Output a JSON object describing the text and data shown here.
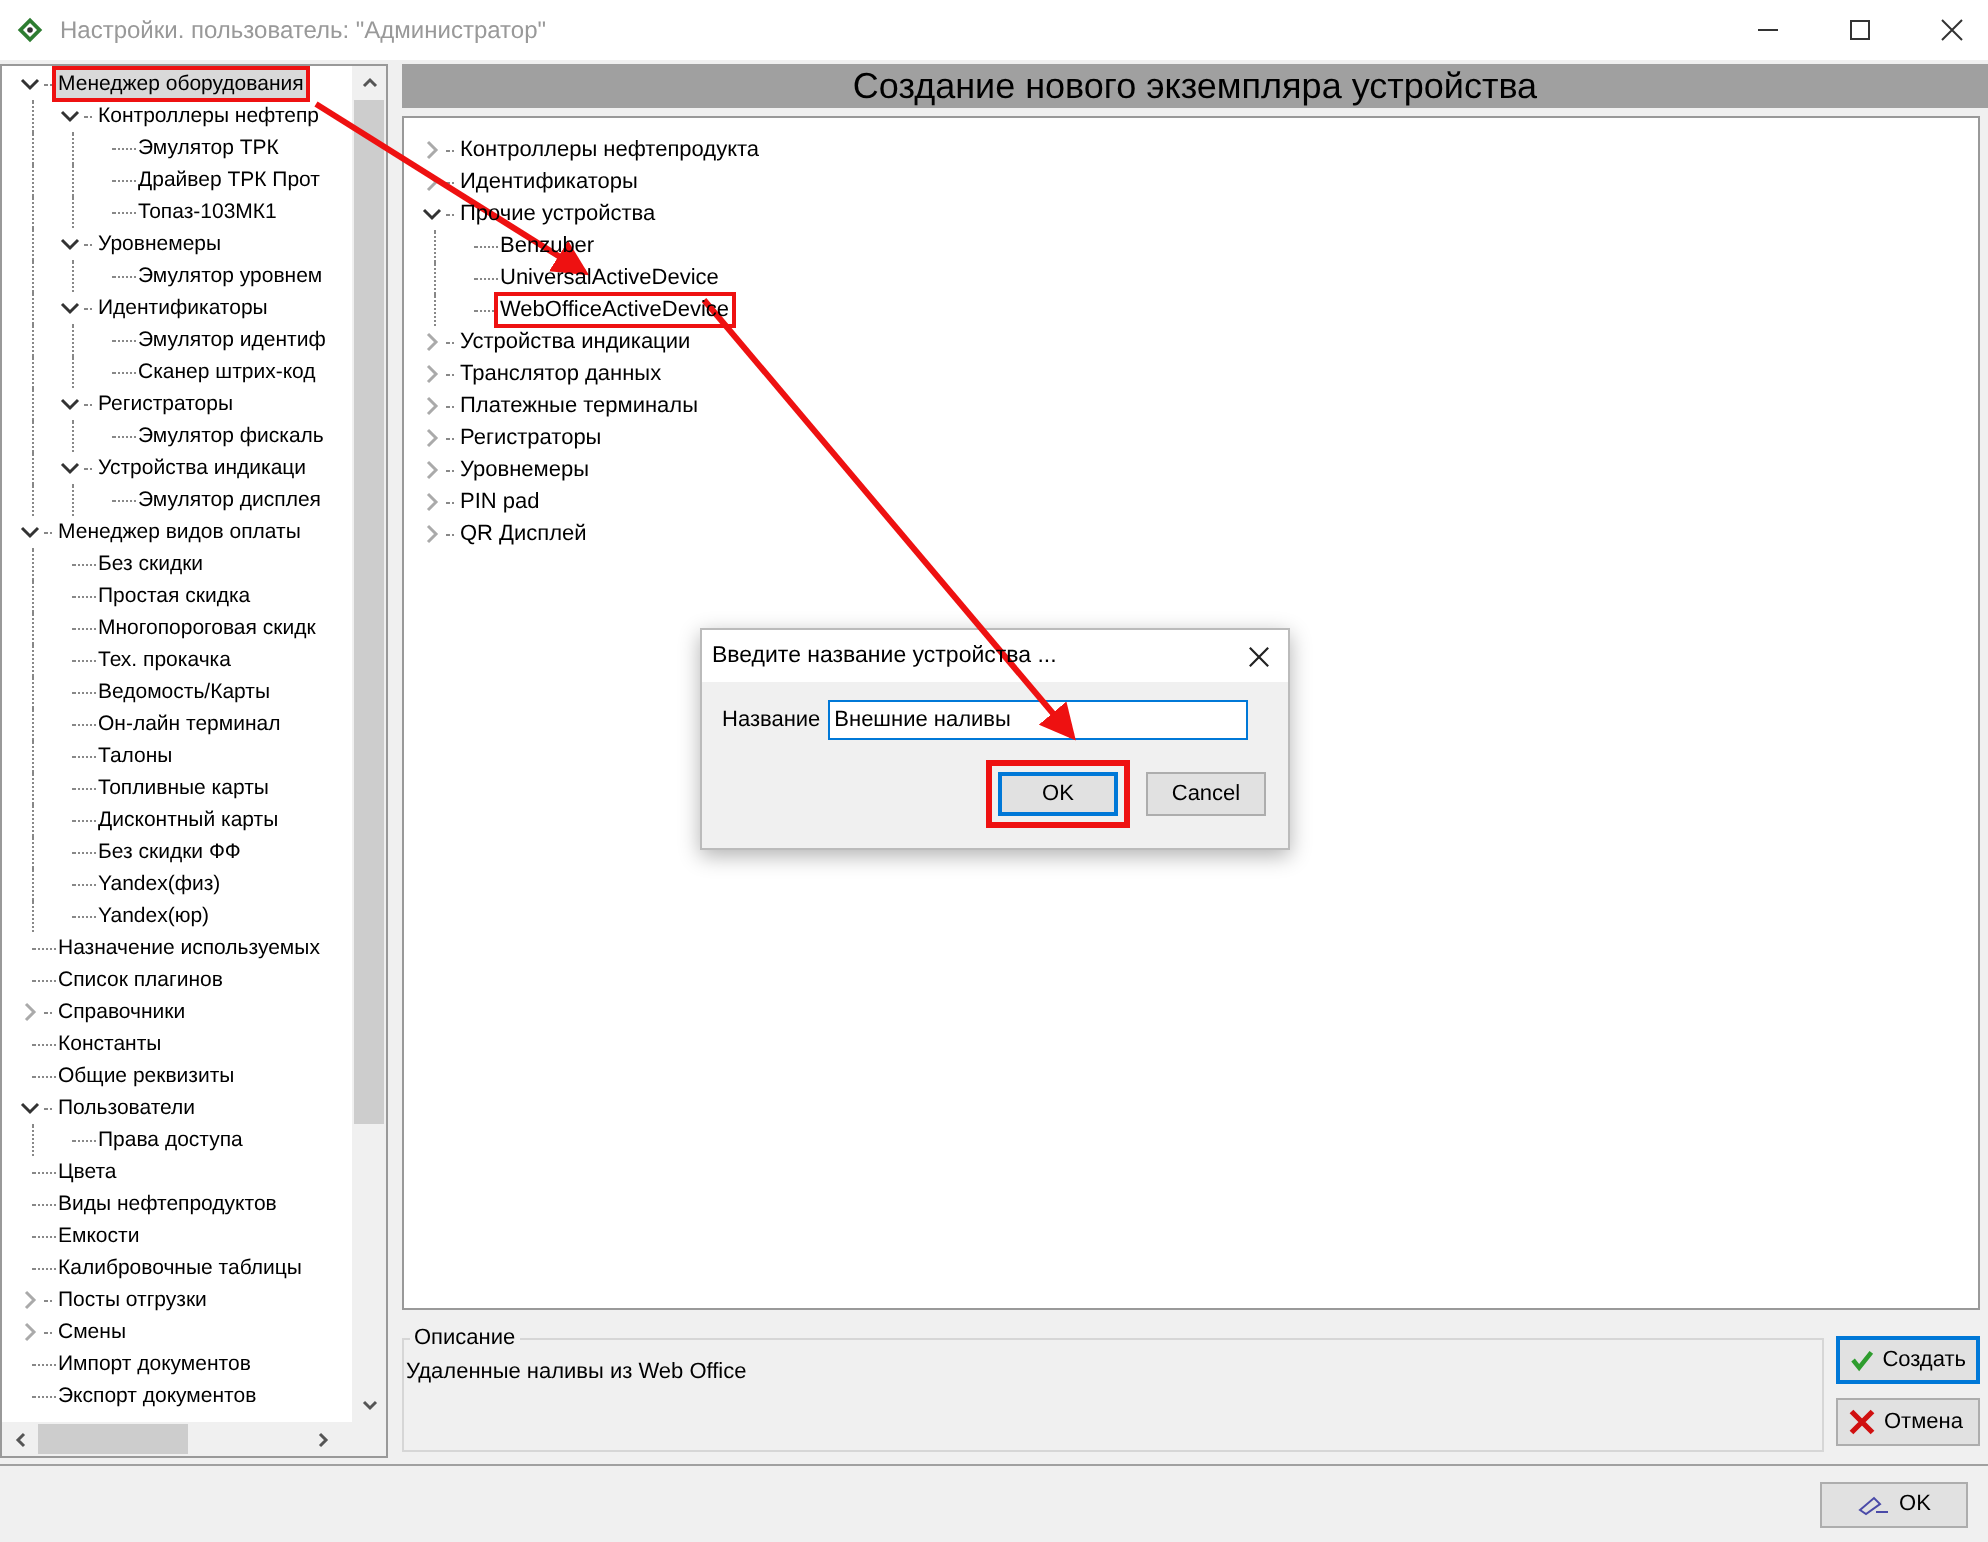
{
  "window": {
    "title": "Настройки. пользователь: \"Администратор\""
  },
  "settings_tree": [
    {
      "label": "Менеджер оборудования",
      "expanded": true,
      "selected": true,
      "marked": true,
      "children": [
        {
          "label": "Контроллеры нефтепр",
          "expanded": true,
          "selected": false,
          "marked": false,
          "children": [
            {
              "label": "Эмулятор ТРК",
              "selected": false,
              "marked": false
            },
            {
              "label": "Драйвер ТРК Прот",
              "selected": false,
              "marked": false
            },
            {
              "label": "Топаз-103МК1",
              "selected": false,
              "marked": false
            }
          ]
        },
        {
          "label": "Уровнемеры",
          "expanded": true,
          "selected": false,
          "marked": false,
          "children": [
            {
              "label": "Эмулятор уровнем",
              "selected": false,
              "marked": false
            }
          ]
        },
        {
          "label": "Идентификаторы",
          "expanded": true,
          "selected": false,
          "marked": false,
          "children": [
            {
              "label": "Эмулятор идентиф",
              "selected": false,
              "marked": false
            },
            {
              "label": "Сканер штрих-код",
              "selected": false,
              "marked": false
            }
          ]
        },
        {
          "label": "Регистраторы",
          "expanded": true,
          "selected": false,
          "marked": false,
          "children": [
            {
              "label": "Эмулятор фискаль",
              "selected": false,
              "marked": false
            }
          ]
        },
        {
          "label": "Устройства индикаци",
          "expanded": true,
          "selected": false,
          "marked": false,
          "children": [
            {
              "label": "Эмулятор дисплея",
              "selected": false,
              "marked": false
            }
          ]
        }
      ]
    },
    {
      "label": "Менеджер видов оплаты",
      "expanded": true,
      "selected": false,
      "marked": false,
      "children": [
        {
          "label": "Без скидки",
          "selected": false,
          "marked": false
        },
        {
          "label": "Простая скидка",
          "selected": false,
          "marked": false
        },
        {
          "label": "Многопороговая скидк",
          "selected": false,
          "marked": false
        },
        {
          "label": "Тех. прокачка",
          "selected": false,
          "marked": false
        },
        {
          "label": "Ведомость/Карты",
          "selected": false,
          "marked": false
        },
        {
          "label": "Он-лайн терминал",
          "selected": false,
          "marked": false
        },
        {
          "label": "Талоны",
          "selected": false,
          "marked": false
        },
        {
          "label": "Топливные карты",
          "selected": false,
          "marked": false
        },
        {
          "label": "Дисконтный карты",
          "selected": false,
          "marked": false
        },
        {
          "label": "Без скидки ФФ",
          "selected": false,
          "marked": false
        },
        {
          "label": "Yandex(физ)",
          "selected": false,
          "marked": false
        },
        {
          "label": "Yandex(юр)",
          "selected": false,
          "marked": false
        }
      ]
    },
    {
      "label": "Назначение используемых",
      "selected": false,
      "marked": false
    },
    {
      "label": "Список плагинов",
      "selected": false,
      "marked": false
    },
    {
      "label": "Справочники",
      "expanded": false,
      "selected": false,
      "marked": false
    },
    {
      "label": "Константы",
      "selected": false,
      "marked": false
    },
    {
      "label": "Общие реквизиты",
      "selected": false,
      "marked": false
    },
    {
      "label": "Пользователи",
      "expanded": true,
      "selected": false,
      "marked": false,
      "children": [
        {
          "label": "Права доступа",
          "selected": false,
          "marked": false
        }
      ]
    },
    {
      "label": "Цвета",
      "selected": false,
      "marked": false
    },
    {
      "label": "Виды нефтепродуктов",
      "selected": false,
      "marked": false
    },
    {
      "label": "Емкости",
      "selected": false,
      "marked": false
    },
    {
      "label": "Калибровочные таблицы",
      "selected": false,
      "marked": false
    },
    {
      "label": "Посты отгрузки",
      "expanded": false,
      "selected": false,
      "marked": false
    },
    {
      "label": "Смены",
      "expanded": false,
      "selected": false,
      "marked": false
    },
    {
      "label": "Импорт документов",
      "selected": false,
      "marked": false
    },
    {
      "label": "Экспорт документов",
      "selected": false,
      "marked": false
    }
  ],
  "panel": {
    "title": "Создание нового экземпляра устройства",
    "device_tree": [
      {
        "label": "Контроллеры нефтепродукта",
        "expanded": false,
        "marked": false
      },
      {
        "label": "Идентификаторы",
        "expanded": false,
        "marked": false
      },
      {
        "label": "Прочие устройства",
        "expanded": true,
        "marked": false,
        "children": [
          {
            "label": "Benzuber",
            "marked": false
          },
          {
            "label": "UniversalActiveDevice",
            "marked": false
          },
          {
            "label": "WebOfficeActiveDevice",
            "marked": true
          }
        ]
      },
      {
        "label": "Устройства индикации",
        "expanded": false,
        "marked": false
      },
      {
        "label": "Транслятор данных",
        "expanded": false,
        "marked": false
      },
      {
        "label": "Платежные терминалы",
        "expanded": false,
        "marked": false
      },
      {
        "label": "Регистраторы",
        "expanded": false,
        "marked": false
      },
      {
        "label": "Уровнемеры",
        "expanded": false,
        "marked": false
      },
      {
        "label": "PIN pad",
        "expanded": false,
        "marked": false
      },
      {
        "label": "QR Дисплей",
        "expanded": false,
        "marked": false
      }
    ],
    "description": {
      "legend": "Описание",
      "text": "Удаленные наливы из Web Office"
    },
    "buttons": [
      {
        "label": "Создать",
        "kind": "create",
        "focused": true
      },
      {
        "label": "Отмена",
        "kind": "cancel",
        "focused": false
      }
    ]
  },
  "dialog": {
    "title": "Введите название устройства ...",
    "field_label": "Название",
    "value": "Внешние наливы",
    "buttons": [
      {
        "label": "OK",
        "focused": true,
        "marked": true
      },
      {
        "label": "Cancel",
        "focused": false,
        "marked": false
      }
    ]
  },
  "footer": {
    "button": "OK"
  }
}
